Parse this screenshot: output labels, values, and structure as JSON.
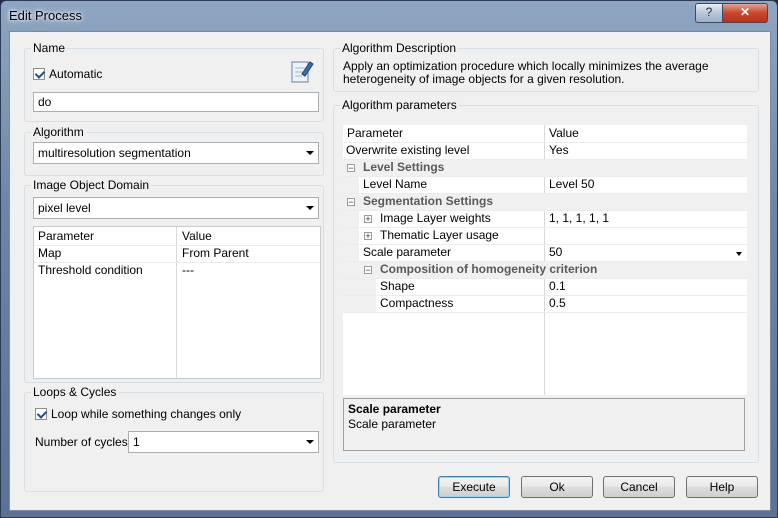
{
  "window": {
    "title": "Edit Process",
    "help_label": "?",
    "close_label": "✕"
  },
  "name_group": {
    "label": "Name",
    "automatic_label": "Automatic",
    "automatic_checked": true,
    "name_value": "do",
    "edit_icon": "edit-document-icon"
  },
  "algorithm_group": {
    "label": "Algorithm",
    "selected": "multiresolution segmentation"
  },
  "domain_group": {
    "label": "Image Object Domain",
    "selected": "pixel level",
    "headers": {
      "parameter": "Parameter",
      "value": "Value"
    },
    "rows": [
      {
        "parameter": "Map",
        "value": "From Parent"
      },
      {
        "parameter": "Threshold condition",
        "value": "---"
      }
    ]
  },
  "loops_group": {
    "label": "Loops & Cycles",
    "loop_label": "Loop while something changes only",
    "loop_checked": true,
    "cycles_label": "Number of cycles",
    "cycles_value": "1"
  },
  "description_group": {
    "label": "Algorithm Description",
    "text": "Apply an optimization procedure which locally minimizes the average heterogeneity of image objects for a given resolution."
  },
  "params_group": {
    "label": "Algorithm parameters",
    "headers": {
      "parameter": "Parameter",
      "value": "Value"
    },
    "rows": [
      {
        "parameter": "Overwrite existing level",
        "value": "Yes"
      },
      {
        "parameter": "Level Settings",
        "value": ""
      },
      {
        "parameter": "Level Name",
        "value": "Level 50"
      },
      {
        "parameter": "Segmentation Settings",
        "value": ""
      },
      {
        "parameter": "Image Layer weights",
        "value": "1, 1, 1, 1, 1"
      },
      {
        "parameter": "Thematic Layer usage",
        "value": ""
      },
      {
        "parameter": "Scale parameter",
        "value": "50"
      },
      {
        "parameter": "Composition of homogeneity criterion",
        "value": ""
      },
      {
        "parameter": "Shape",
        "value": "0.1"
      },
      {
        "parameter": "Compactness",
        "value": "0.5"
      }
    ],
    "info_title": "Scale parameter",
    "info_text": "Scale parameter"
  },
  "buttons": {
    "execute": "Execute",
    "ok": "Ok",
    "cancel": "Cancel",
    "help": "Help"
  }
}
